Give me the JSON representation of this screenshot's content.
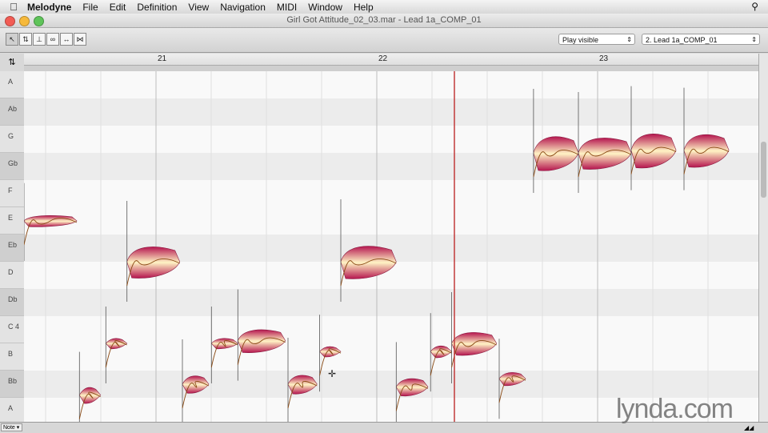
{
  "menubar": {
    "app_name": "Melodyne",
    "items": [
      "File",
      "Edit",
      "Definition",
      "View",
      "Navigation",
      "MIDI",
      "Window",
      "Help"
    ]
  },
  "window": {
    "title": "Girl Got Attitude_02_03.mar - Lead 1a_COMP_01"
  },
  "toolbar": {
    "tools": [
      "pointer-tool",
      "pitch-tool",
      "formant-tool",
      "amplitude-tool",
      "time-tool",
      "separation-tool"
    ],
    "playback_select": "Play visible",
    "track_select": "2. Lead 1a_COMP_01"
  },
  "ruler": {
    "bars": [
      "21",
      "22",
      "23"
    ]
  },
  "keys": [
    "A",
    "Ab",
    "G",
    "Gb",
    "F",
    "E",
    "Eb",
    "D",
    "Db",
    "C 4",
    "B",
    "Bb",
    "A"
  ],
  "bottombar": {
    "note_button": "Note"
  },
  "watermark": "lynda.com",
  "colors": {
    "blob_dark": "#b5154f",
    "blob_light": "#fff3c4",
    "pitch_line": "#8a4a14",
    "playhead": "#c23a3a"
  },
  "notes": [
    {
      "start": 0.0,
      "end": 1.0,
      "pitch": 5,
      "amp": 0.18
    },
    {
      "start": 1.05,
      "end": 1.45,
      "pitch": 11.4,
      "amp": 0.35
    },
    {
      "start": 1.55,
      "end": 1.95,
      "pitch": 9.5,
      "amp": 0.15
    },
    {
      "start": 1.95,
      "end": 2.95,
      "pitch": 6.5,
      "amp": 0.9
    },
    {
      "start": 3.0,
      "end": 3.5,
      "pitch": 11.0,
      "amp": 0.4
    },
    {
      "start": 3.55,
      "end": 4.05,
      "pitch": 9.5,
      "amp": 0.15
    },
    {
      "start": 4.05,
      "end": 4.95,
      "pitch": 9.4,
      "amp": 0.6
    },
    {
      "start": 5.0,
      "end": 5.55,
      "pitch": 11.0,
      "amp": 0.45
    },
    {
      "start": 5.6,
      "end": 6.0,
      "pitch": 9.8,
      "amp": 0.15
    },
    {
      "start": 6.0,
      "end": 7.05,
      "pitch": 6.5,
      "amp": 0.95
    },
    {
      "start": 7.05,
      "end": 7.65,
      "pitch": 11.1,
      "amp": 0.4
    },
    {
      "start": 7.7,
      "end": 8.1,
      "pitch": 9.8,
      "amp": 0.2
    },
    {
      "start": 8.1,
      "end": 8.95,
      "pitch": 9.5,
      "amp": 0.6
    },
    {
      "start": 9.0,
      "end": 9.5,
      "pitch": 10.8,
      "amp": 0.25
    },
    {
      "start": 9.65,
      "end": 10.5,
      "pitch": 2.5,
      "amp": 1.0
    },
    {
      "start": 10.5,
      "end": 11.5,
      "pitch": 2.5,
      "amp": 0.9
    },
    {
      "start": 11.5,
      "end": 12.35,
      "pitch": 2.4,
      "amp": 1.0
    },
    {
      "start": 12.5,
      "end": 13.35,
      "pitch": 2.4,
      "amp": 0.95
    }
  ]
}
